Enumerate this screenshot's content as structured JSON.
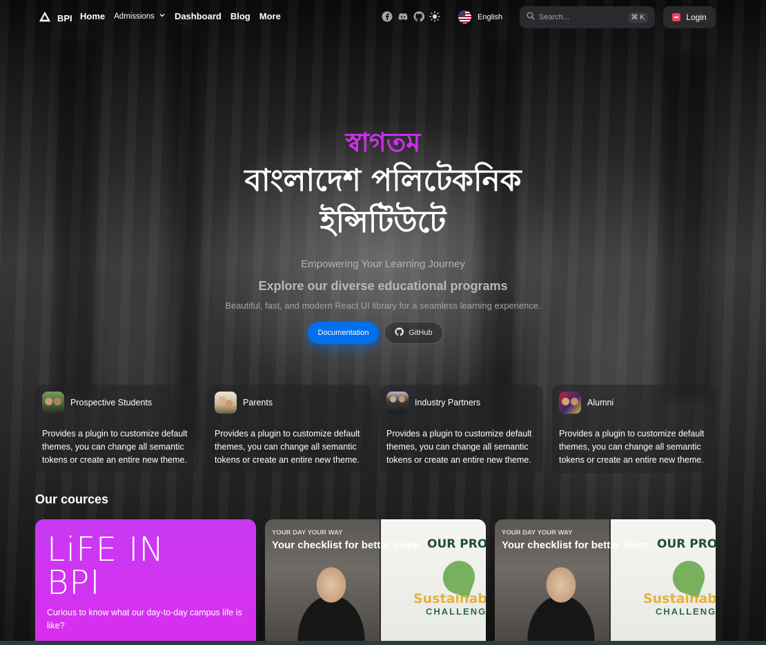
{
  "nav": {
    "brand": "BPI",
    "links": [
      "Home",
      "Admissions",
      "Dashboard",
      "Blog",
      "More"
    ],
    "socials": [
      "facebook-icon",
      "discord-icon",
      "github-icon",
      "sun-icon"
    ],
    "language": "English",
    "search_placeholder": "Search...",
    "search_shortcut": "⌘ K",
    "login_label": "Login"
  },
  "hero": {
    "welcome": "স্বাগতম",
    "title": "বাংলাদেশ পলিটেকনিক ইন্সিটিউটে",
    "tagline": "Empowering Your Learning Journey",
    "explore": "Explore our diverse educational programs",
    "description": "Beautiful, fast, and modern React UI library for a seamless learning experience.",
    "doc_button": "Documentation",
    "github_button": "GitHub"
  },
  "cards": [
    {
      "title": "Prospective Students",
      "text": "Provides a plugin to customize default themes, you can change all semantic tokens or create an entire new theme."
    },
    {
      "title": "Parents",
      "text": "Provides a plugin to customize default themes, you can change all semantic tokens or create an entire new theme."
    },
    {
      "title": "Industry Partners",
      "text": "Provides a plugin to customize default themes, you can change all semantic tokens or create an entire new theme."
    },
    {
      "title": "Alumni",
      "text": "Provides a plugin to customize default themes, you can change all semantic tokens or create an entire new theme."
    }
  ],
  "courses": {
    "section_title": "Our cources",
    "items": [
      {
        "title_line1": "LiFE IN",
        "title_line2": "BPI",
        "description": "Curious to know what our day-to-day campus life is like?"
      },
      {
        "eyebrow": "YOUR DAY YOUR WAY",
        "headline": "Your checklist for better sleep",
        "poster_title": "OUR PROPOSA",
        "poster_word": "Sustainabi",
        "poster_sub": "CHALLENG"
      },
      {
        "eyebrow": "YOUR DAY YOUR WAY",
        "headline": "Your checklist for better sleep",
        "poster_title": "OUR PROPOSA",
        "poster_word": "Sustainabi",
        "poster_sub": "CHALLENG"
      }
    ]
  },
  "colors": {
    "accent": "#006fee",
    "welcome": "#d22ef0",
    "course_pink": "#d92df0"
  }
}
